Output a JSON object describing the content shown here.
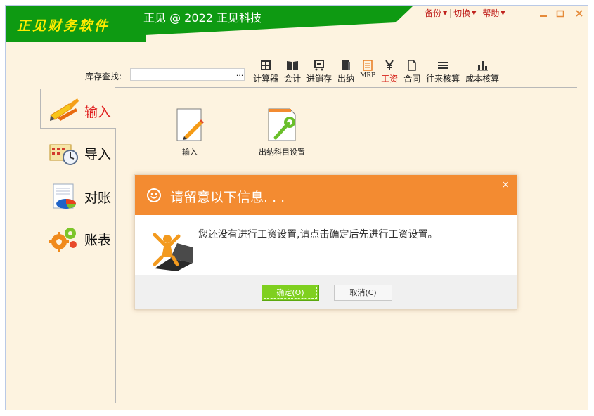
{
  "app": {
    "logo_text": "正见财务软件",
    "title": "正见 @ 2022 正见科技"
  },
  "top_menu": [
    {
      "label": "备份"
    },
    {
      "label": "切换"
    },
    {
      "label": "帮助"
    }
  ],
  "search": {
    "label": "库存查找:",
    "value": "",
    "button": "..."
  },
  "toolbar": [
    {
      "label": "计算器",
      "icon": "calculator-icon"
    },
    {
      "label": "会计",
      "icon": "book-icon"
    },
    {
      "label": "进销存",
      "icon": "cart-icon"
    },
    {
      "label": "出纳",
      "icon": "ledger-icon"
    },
    {
      "label": "MRP",
      "icon": "mrp-icon"
    },
    {
      "label": "工资",
      "icon": "yen-icon"
    },
    {
      "label": "合同",
      "icon": "document-icon"
    },
    {
      "label": "往来核算",
      "icon": "list-icon"
    },
    {
      "label": "成本核算",
      "icon": "bar-chart-icon"
    }
  ],
  "nav": [
    {
      "label": "输入",
      "icon": "input-pen-icon"
    },
    {
      "label": "导入",
      "icon": "calendar-clock-icon"
    },
    {
      "label": "对账",
      "icon": "reconcile-chart-icon"
    },
    {
      "label": "账表",
      "icon": "gears-icon"
    }
  ],
  "content_items": [
    {
      "label": "输入",
      "icon": "pencil-document-icon"
    },
    {
      "label": "出纳科目设置",
      "icon": "wrench-document-icon"
    }
  ],
  "dialog": {
    "title": "请留意以下信息. . .",
    "close": "×",
    "message": "您还没有进行工资设置,请点击确定后先进行工资设置。",
    "ok_label": "确定(O)",
    "cancel_label": "取消(C)"
  },
  "colors": {
    "banner": "#0e9a12",
    "logo": "#ffeb00",
    "accent_red": "#c0221e",
    "dialog_header": "#f38b31",
    "ok_button": "#7fd01f",
    "background": "#fdf3e0"
  }
}
